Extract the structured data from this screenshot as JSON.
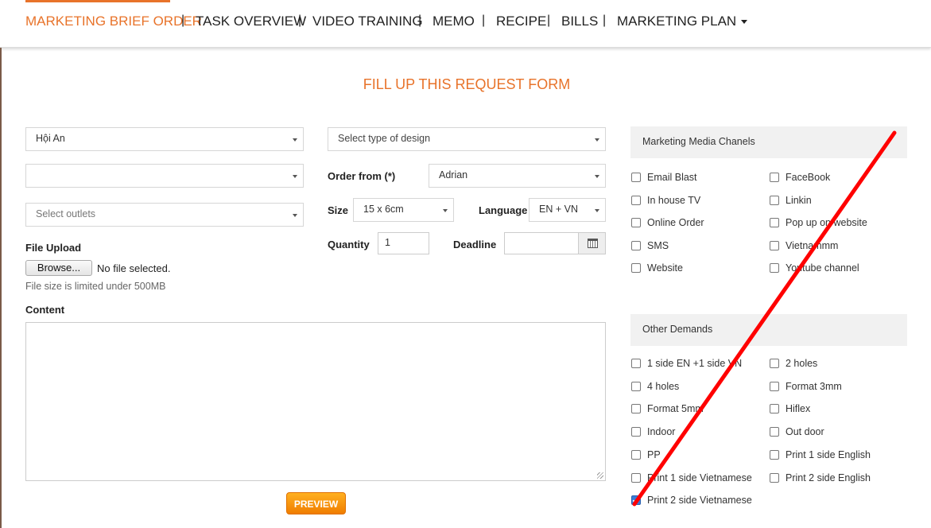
{
  "nav": {
    "items": [
      {
        "label": "MARKETING BRIEF ORDER"
      },
      {
        "label": "TASK OVERVIEW"
      },
      {
        "label": "VIDEO TRAINING"
      },
      {
        "label": "MEMO"
      },
      {
        "label": "RECIPE"
      },
      {
        "label": "BILLS"
      },
      {
        "label": "MARKETING PLAN"
      }
    ],
    "separator": "|"
  },
  "form": {
    "title": "FILL UP THIS REQUEST FORM",
    "location_value": "Hội An",
    "second_select_value": "",
    "outlets_placeholder": "Select outlets",
    "design_type_placeholder": "Select type of design",
    "order_from_label": "Order from (*)",
    "order_from_value": "Adrian",
    "size_label": "Size",
    "size_value": "15 x 6cm",
    "language_label": "Language",
    "language_value": "EN + VN",
    "quantity_label": "Quantity",
    "quantity_value": "1",
    "deadline_label": "Deadline",
    "deadline_value": "",
    "file_upload_label": "File Upload",
    "browse_label": "Browse...",
    "no_file_text": "No file selected.",
    "file_size_note": "File size is limited under 500MB",
    "content_label": "Content",
    "content_value": "",
    "preview_label": "PREVIEW"
  },
  "media": {
    "title": "Marketing Media Chanels",
    "left": [
      {
        "label": "Email Blast",
        "checked": false
      },
      {
        "label": "In house TV",
        "checked": false
      },
      {
        "label": "Online Order",
        "checked": false
      },
      {
        "label": "SMS",
        "checked": false
      },
      {
        "label": "Website",
        "checked": false
      }
    ],
    "right": [
      {
        "label": "FaceBook",
        "checked": false
      },
      {
        "label": "Linkin",
        "checked": false
      },
      {
        "label": "Pop up on website",
        "checked": false
      },
      {
        "label": "Vietnammm",
        "checked": false
      },
      {
        "label": "Youtube channel",
        "checked": false
      }
    ]
  },
  "demands": {
    "title": "Other Demands",
    "left": [
      {
        "label": "1 side EN +1 side VN",
        "checked": false
      },
      {
        "label": "4 holes",
        "checked": false
      },
      {
        "label": "Format 5mm",
        "checked": false
      },
      {
        "label": "Indoor",
        "checked": false
      },
      {
        "label": "PP",
        "checked": false
      },
      {
        "label": "Print 1 side Vietnamese",
        "checked": false
      },
      {
        "label": "Print 2 side Vietnamese",
        "checked": true
      }
    ],
    "right": [
      {
        "label": "2 holes",
        "checked": false
      },
      {
        "label": "Format 3mm",
        "checked": false
      },
      {
        "label": "Hiflex",
        "checked": false
      },
      {
        "label": "Out door",
        "checked": false
      },
      {
        "label": "Print 1 side English",
        "checked": false
      },
      {
        "label": "Print 2 side English",
        "checked": false
      }
    ]
  },
  "colors": {
    "accent": "#e8732a",
    "slash": "#ff0000"
  }
}
